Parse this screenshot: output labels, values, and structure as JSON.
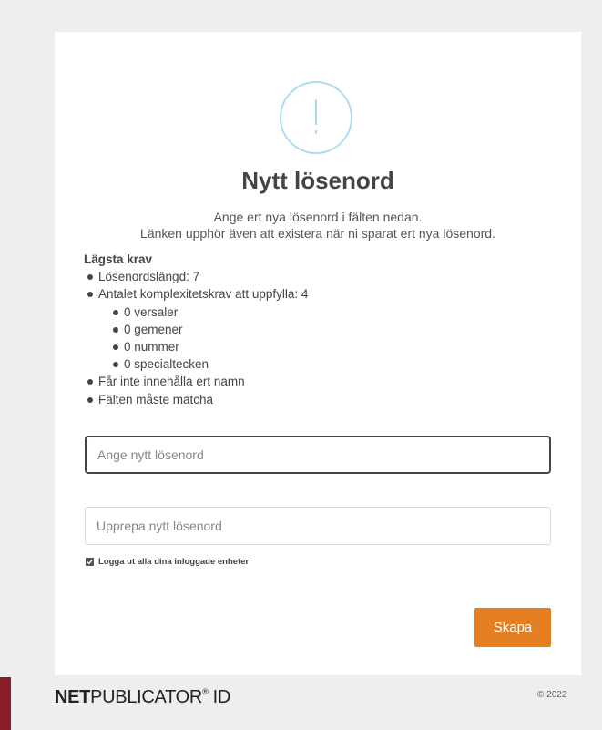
{
  "dialog": {
    "title": "Nytt lösenord",
    "subtitle_line1": "Ange ert nya lösenord i fälten nedan.",
    "subtitle_line2": "Länken upphör även att existera när ni sparat ert nya lösenord."
  },
  "requirements": {
    "heading": "Lägsta krav",
    "length": "Lösenordslängd: 7",
    "complexity": "Antalet komplexitetskrav att uppfylla: 4",
    "sub": [
      "0 versaler",
      "0 gemener",
      "0 nummer",
      "0 specialtecken"
    ],
    "no_name": "Får inte innehålla ert namn",
    "must_match": "Fälten måste matcha"
  },
  "form": {
    "new_password_placeholder": "Ange nytt lösenord",
    "new_password_value": "",
    "repeat_password_placeholder": "Upprepa nytt lösenord",
    "repeat_password_value": "",
    "logout_label": "Logga ut alla dina inloggade enheter",
    "logout_checked": true,
    "create_label": "Skapa"
  },
  "footer": {
    "logo_bold": "NET",
    "logo_regular": "PUBLICATOR",
    "logo_reg_mark": "®",
    "logo_suffix": " ID",
    "copyright": "© 2022"
  },
  "colors": {
    "accent": "#e67f22",
    "icon_ring": "#a9ddee",
    "brand_strip": "#8a1f2b"
  },
  "icons": {
    "alert": "exclamation-circle-icon",
    "checkbox": "checkmark-icon"
  }
}
